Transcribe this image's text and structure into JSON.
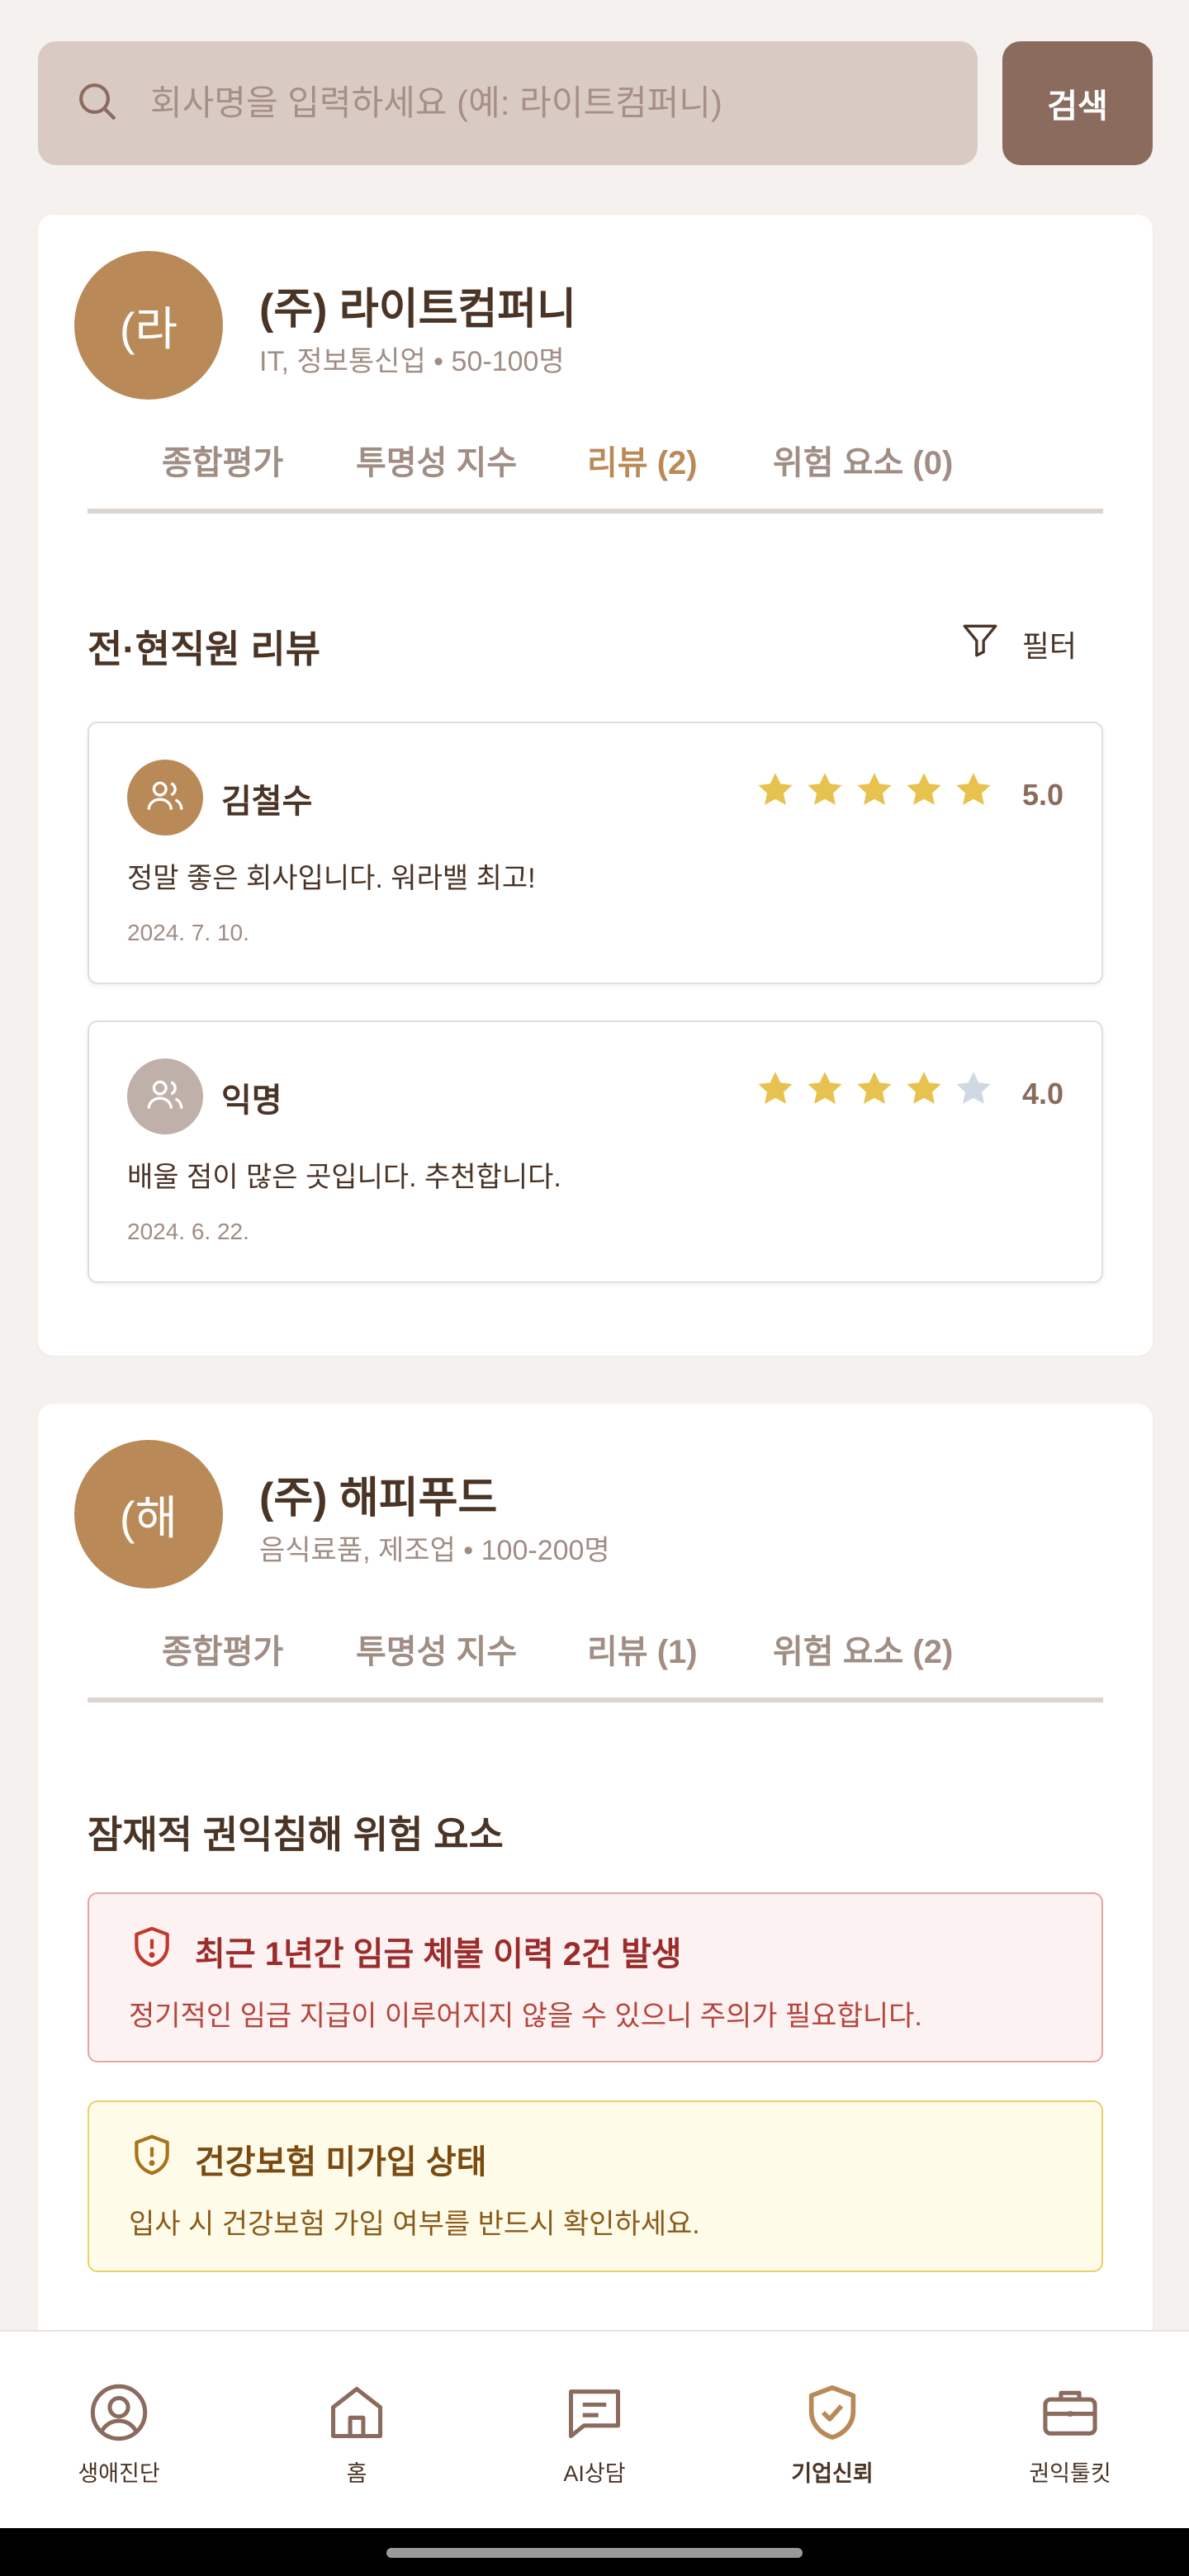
{
  "search": {
    "placeholder": "회사명을 입력하세요 (예: 라이트컴퍼니)",
    "button_label": "검색"
  },
  "companies": [
    {
      "avatar_text": "(라",
      "name": "(주) 라이트컴퍼니",
      "meta": "IT, 정보통신업 • 50-100명",
      "tabs": [
        "종합평가",
        "투명성 지수",
        "리뷰 (2)",
        "위험 요소 (0)"
      ],
      "active_tab": 2,
      "section_title": "전·현직원 리뷰",
      "filter_label": "필터",
      "reviews": [
        {
          "name": "김철수",
          "rating": 5,
          "rating_text": "5.0",
          "text": "정말 좋은 회사입니다. 워라밸 최고!",
          "date": "2024. 7. 10.",
          "avatar_color": "#b98a58"
        },
        {
          "name": "익명",
          "rating": 4,
          "rating_text": "4.0",
          "text": "배울 점이 많은 곳입니다. 추천합니다.",
          "date": "2024. 6. 22.",
          "avatar_color": "#bfb0aa"
        }
      ]
    },
    {
      "avatar_text": "(해",
      "name": "(주) 해피푸드",
      "meta": "음식료품, 제조업 • 100-200명",
      "tabs": [
        "종합평가",
        "투명성 지수",
        "리뷰 (1)",
        "위험 요소 (2)"
      ],
      "active_tab": 3,
      "section_title": "잠재적 권익침해 위험 요소",
      "risks": [
        {
          "level": "high",
          "title": "최근 1년간 임금 체불 이력 2건 발생",
          "desc": "정기적인 임금 지급이 이루어지지 않을 수 있으니 주의가 필요합니다."
        },
        {
          "level": "medium",
          "title": "건강보험 미가입 상태",
          "desc": "입사 시 건강보험 가입 여부를 반드시 확인하세요."
        }
      ]
    }
  ],
  "nav": [
    {
      "label": "생애진단",
      "icon": "user-circle-icon"
    },
    {
      "label": "홈",
      "icon": "home-icon"
    },
    {
      "label": "AI상담",
      "icon": "chat-icon"
    },
    {
      "label": "기업신뢰",
      "icon": "shield-check-icon",
      "active": true
    },
    {
      "label": "권익툴킷",
      "icon": "briefcase-icon"
    }
  ],
  "colors": {
    "accent": "#b98a58",
    "brown_dark": "#4a3426",
    "search_btn": "#8b6b5e",
    "star_on": "#e8c24f",
    "star_off": "#cfd8e3"
  }
}
